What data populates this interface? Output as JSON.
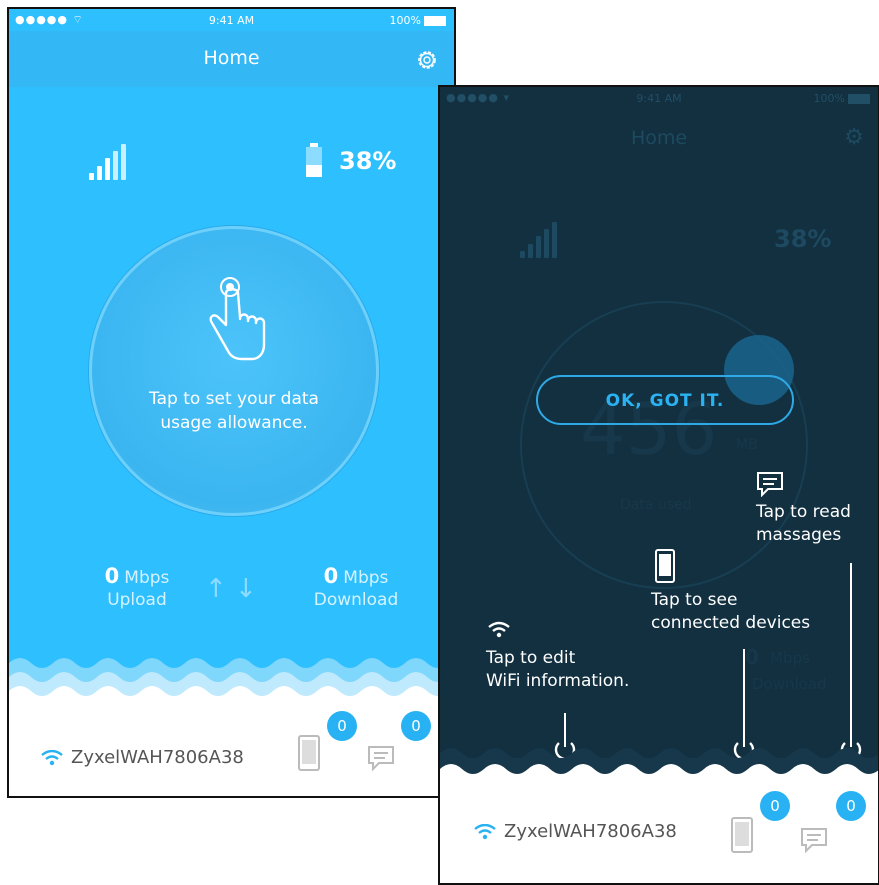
{
  "status_bar": {
    "carrier": "●●●●● ",
    "time": "9:41 AM",
    "battery": "100%"
  },
  "nav": {
    "title": "Home"
  },
  "battery_percent": "38%",
  "data_circle": {
    "line1": "Tap to set your data",
    "line2": "usage allowance."
  },
  "upload": {
    "value": "0",
    "unit": "Mbps",
    "label": "Upload"
  },
  "download": {
    "value": "0",
    "unit": "Mbps",
    "label": "Download"
  },
  "wifi_ssid": "ZyxelWAH7806A38",
  "connected_devices_count": "0",
  "messages_count": "0",
  "tutorial": {
    "ok_button": "OK, GOT IT.",
    "usage_digits": "456",
    "usage_unit": "MB",
    "usage_label": "Data used",
    "hint_messages_1": "Tap to read",
    "hint_messages_2": "massages",
    "hint_devices_1": "Tap to see",
    "hint_devices_2": "connected devices",
    "hint_wifi_1": "Tap to edit",
    "hint_wifi_2": "WiFi information."
  },
  "colors": {
    "primary": "#2ebfff",
    "nav": "#34b7f5",
    "overlay": "#123040",
    "accent": "#29b2f3"
  }
}
